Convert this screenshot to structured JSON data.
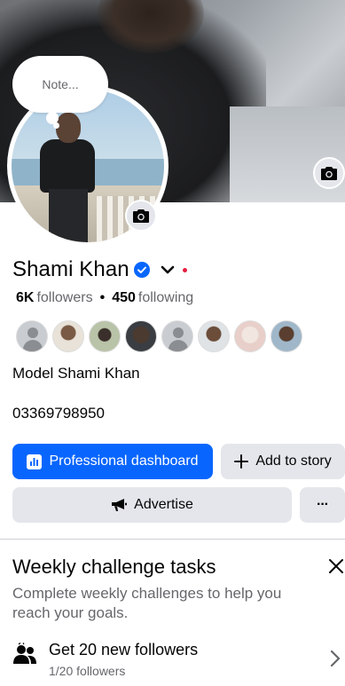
{
  "profile": {
    "note_placeholder": "Note...",
    "name": "Shami Khan",
    "followers_count": "6K",
    "followers_label": "followers",
    "separator": "•",
    "following_count": "450",
    "following_label": "following",
    "bio": "Model Shami Khan",
    "phone": "03369798950"
  },
  "actions": {
    "professional_dashboard": "Professional dashboard",
    "add_to_story": "Add to story",
    "advertise": "Advertise",
    "more": "···"
  },
  "weekly_challenge": {
    "title": "Weekly challenge tasks",
    "description": "Complete weekly challenges to help you reach your goals.",
    "task_title": "Get 20 new followers",
    "task_progress": "1/20 followers"
  },
  "colors": {
    "primary": "#0866ff",
    "secondary_button": "#e4e6eb",
    "muted_text": "#65676b",
    "verified": "#0866ff",
    "alert_dot": "#e41e3f"
  },
  "follower_avatars": [
    "blank-avatar",
    "photo",
    "photo",
    "photo",
    "blank-avatar",
    "photo",
    "photo",
    "photo"
  ]
}
